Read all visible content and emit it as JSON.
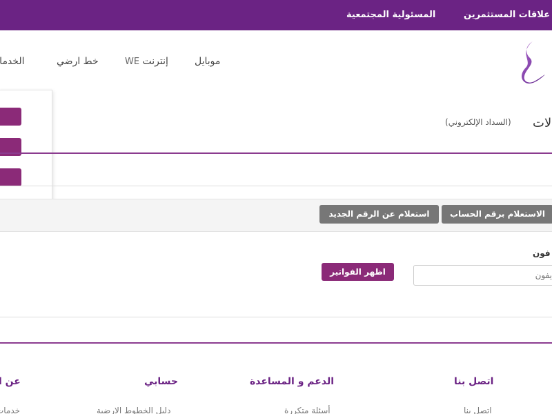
{
  "topbar": {
    "investor_relations": "علاقات المستثمرين",
    "social_responsibility": "المسئولية المجتمعية"
  },
  "nav": {
    "mobile": "موبايل",
    "internet_we": "WE",
    "internet_label": "إنترنت",
    "landline": "خط ارضي",
    "services": "الخدمات"
  },
  "page": {
    "title": "لات.",
    "subtitle": "(السداد الإلكتروني)"
  },
  "tabs": {
    "by_account": "الاستعلام برقم الحساب",
    "new_number": "استعلام عن الرقم الجديد"
  },
  "form": {
    "phone_label": "فون",
    "phone_placeholder": "يفون",
    "show_bills": "اظهر الفواتير"
  },
  "footer": {
    "contact_head": "اتصل بنا",
    "support_head": "الدعم و المساعدة",
    "account_head": "حسابي",
    "about_head": "عن ا",
    "contact_link": "اتصل بنا",
    "faq_link": "أسئلة متكررة",
    "landline_guide_link": "دليل الخطوط الارضية",
    "about_link": "خدمات"
  },
  "colors": {
    "brand_purple": "#6b2384",
    "button_magenta": "#8b2a78",
    "tab_grey": "#777777"
  }
}
